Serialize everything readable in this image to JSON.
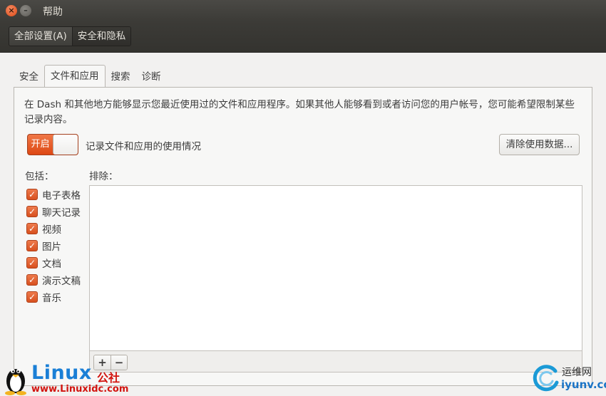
{
  "window": {
    "title": "帮助",
    "close_glyph": "×",
    "minimize_glyph": "–"
  },
  "breadcrumb": {
    "items": [
      {
        "label": "全部设置(A)"
      },
      {
        "label": "安全和隐私"
      }
    ]
  },
  "tabs": [
    {
      "label": "安全"
    },
    {
      "label": "文件和应用"
    },
    {
      "label": "搜索"
    },
    {
      "label": "诊断"
    }
  ],
  "active_tab": "文件和应用",
  "files_apps": {
    "description": "在 Dash 和其他地方能够显示您最近使用过的文件和应用程序。如果其他人能够看到或者访问您的用户帐号，您可能希望限制某些记录内容。",
    "switch": {
      "label": "开启",
      "state": "on"
    },
    "switch_caption": "记录文件和应用的使用情况",
    "clear_button": "清除使用数据...",
    "include_title": "包括：",
    "exclude_title": "排除：",
    "include_items": [
      {
        "label": "电子表格",
        "checked": true
      },
      {
        "label": "聊天记录",
        "checked": true
      },
      {
        "label": "视频",
        "checked": true
      },
      {
        "label": "图片",
        "checked": true
      },
      {
        "label": "文档",
        "checked": true
      },
      {
        "label": "演示文稿",
        "checked": true
      },
      {
        "label": "音乐",
        "checked": true
      }
    ],
    "exclude_items": [],
    "add_button": "+",
    "remove_button": "−"
  },
  "watermarks": {
    "left_brand": "Linux",
    "left_brand_cn": "公社",
    "left_url": "www.Linuxidc.com",
    "right_brand_cn": "运维网",
    "right_domain": "iyunv.com"
  },
  "colors": {
    "accent": "#dd4814",
    "titlebar": "#3c3b37",
    "window_bg": "#f2f1f0"
  }
}
